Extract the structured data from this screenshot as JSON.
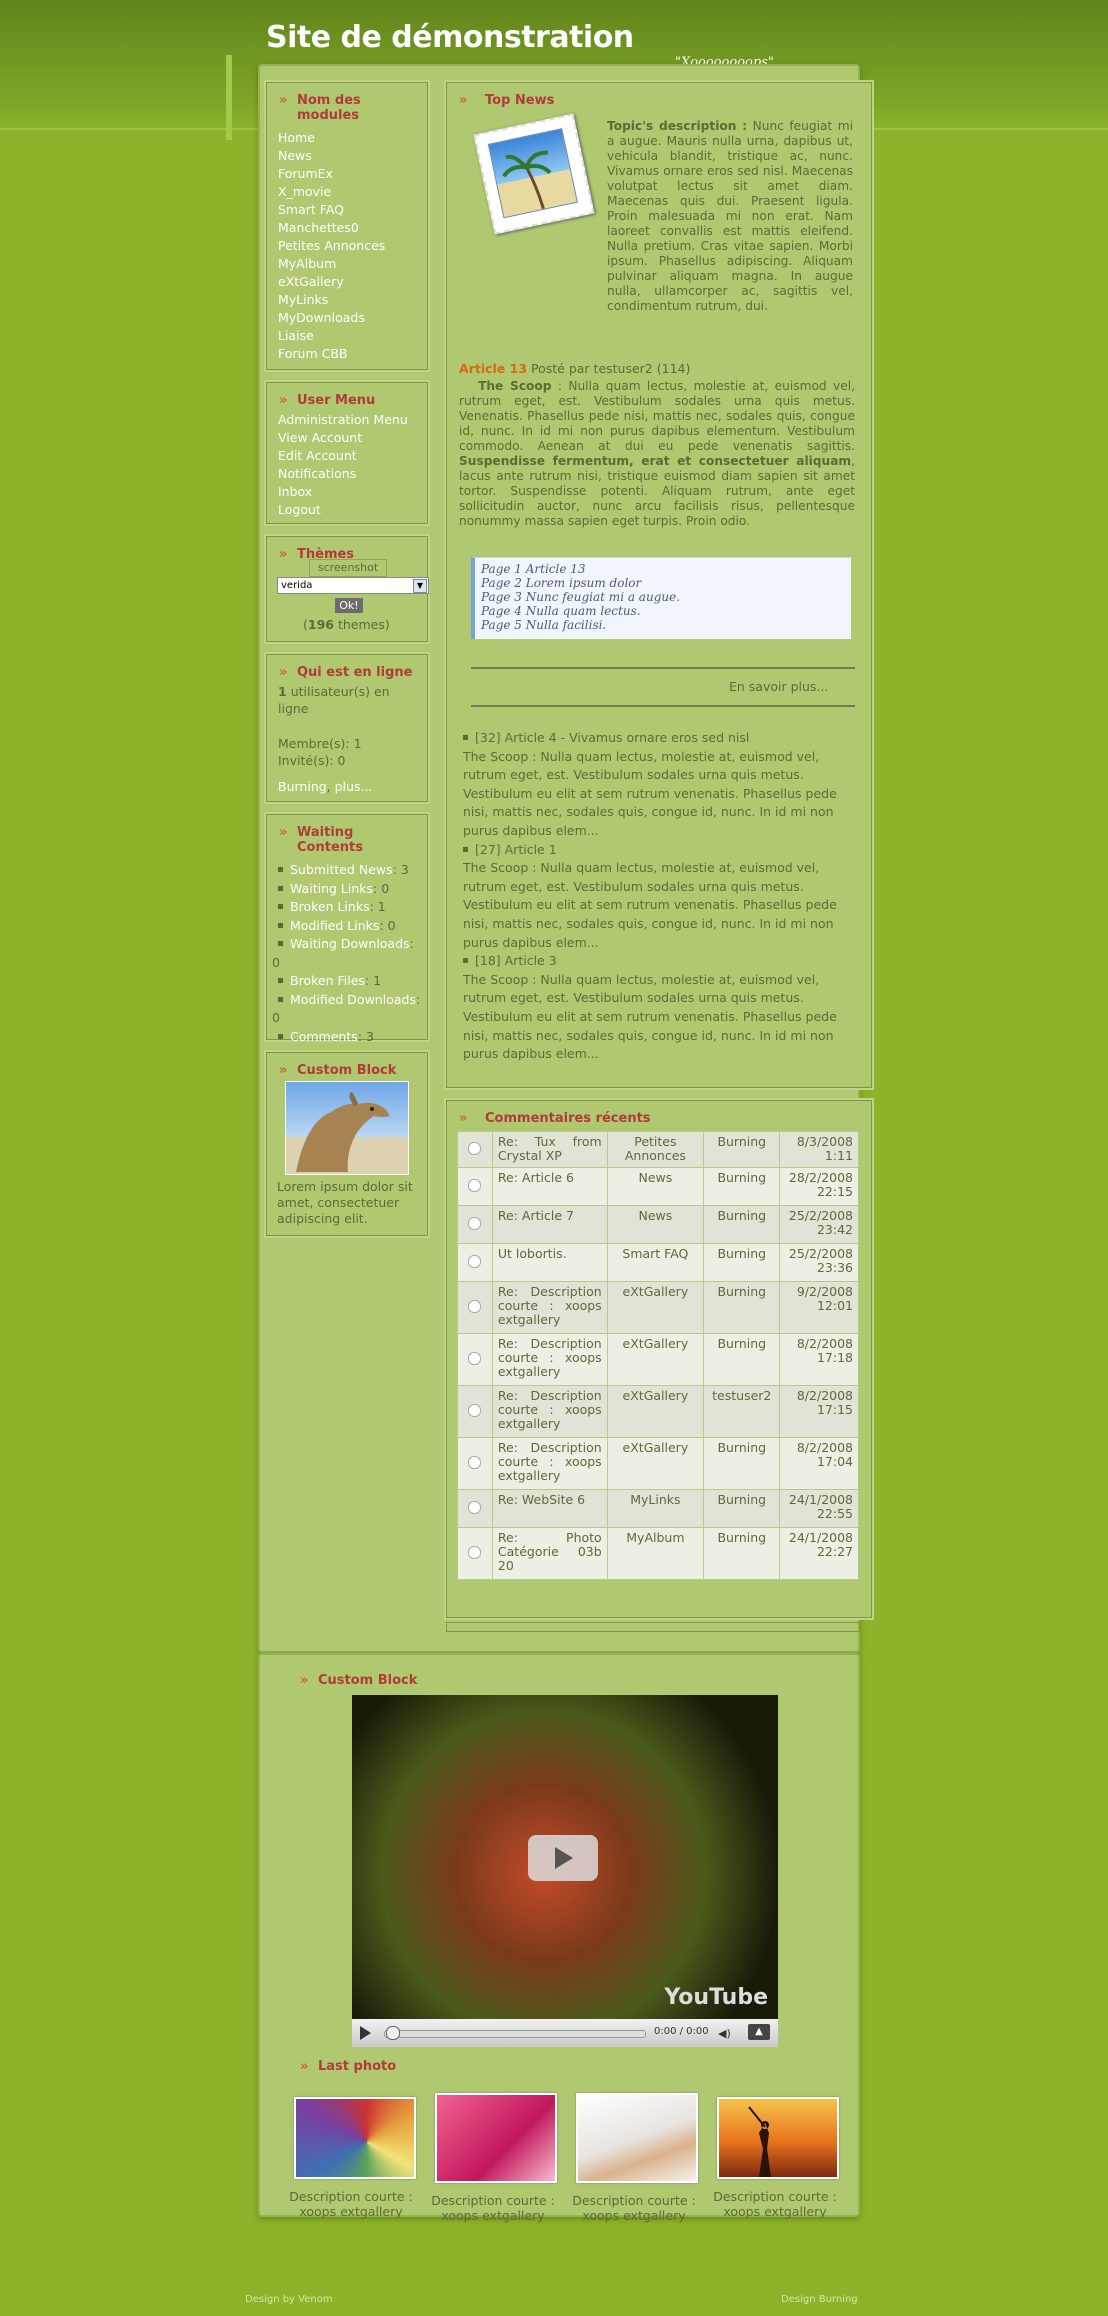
{
  "header": {
    "site_title": "Site de démonstration",
    "slogan": "\"Xoooooooops\""
  },
  "modules": {
    "title": "Nom des modules",
    "items": [
      "Home",
      "News",
      "ForumEx",
      "X_movie",
      "Smart FAQ",
      "Manchettes0",
      "Petites Annonces",
      "MyAlbum",
      "eXtGallery",
      "MyLinks",
      "MyDownloads",
      "Liaise",
      "Forum CBB"
    ]
  },
  "user_menu": {
    "title": "User Menu",
    "items": [
      "Administration Menu",
      "View Account",
      "Edit Account",
      "Notifications",
      "Inbox",
      "Logout"
    ]
  },
  "themes": {
    "title": "Thèmes",
    "screenshot_label": "screenshot",
    "selected": "verida",
    "ok_label": "Ok!",
    "count": "196",
    "count_suffix": "themes)",
    "paren_open": "("
  },
  "online": {
    "title": "Qui est en ligne",
    "count": "1",
    "count_suffix": "utilisateur(s) en ligne",
    "members": "Membre(s): 1",
    "guests": "Invité(s): 0",
    "user": "Burning",
    "more": "plus..."
  },
  "waiting": {
    "title": "Waiting Contents",
    "items": [
      {
        "label": "Submitted News",
        "value": "3"
      },
      {
        "label": "Waiting Links",
        "value": "0"
      },
      {
        "label": "Broken Links",
        "value": "1"
      },
      {
        "label": "Modified Links",
        "value": "0"
      },
      {
        "label": "Waiting Downloads",
        "value": "0"
      },
      {
        "label": "Broken Files",
        "value": "1"
      },
      {
        "label": "Modified Downloads",
        "value": "0"
      },
      {
        "label": "Comments",
        "value": "3"
      }
    ]
  },
  "custom_block": {
    "title": "Custom Block",
    "text": "Lorem ipsum dolor sit amet, consectetuer adipiscing elit."
  },
  "top_news": {
    "title": "Top News",
    "topic_label": "Topic's description :",
    "topic_text": "Nunc feugiat mi a augue. Mauris nulla urna, dapibus ut, vehicula blandit, tristique ac, nunc. Vivamus ornare eros sed nisl. Maecenas volutpat lectus sit amet diam. Maecenas quis dui. Praesent ligula. Proin malesuada mi non erat. Nam laoreet convallis est mattis eleifend. Nulla pretium. Cras vitae sapien. Morbi ipsum. Phasellus adipiscing. Aliquam pulvinar aliquam magna. In augue nulla, ullamcorper ac, sagittis vel, condimentum rutrum, dui.",
    "article_title": "Article 13",
    "posted_by": "Posté par testuser2 (114)",
    "scoop_label": "The Scoop",
    "scoop_text1": " : Nulla quam lectus, molestie at, euismod vel, rutrum eget, est. Vestibulum sodales urna quis metus. Venenatis. Phasellus pede nisi, mattis nec, sodales quis, congue id, nunc. In id mi non purus dapibus elementum. Vestibulum commodo. Aenean at dui eu pede venenatis sagittis. ",
    "scoop_bold": "Suspendisse fermentum, erat et consectetuer aliquam",
    "scoop_text2": ", lacus ante rutrum nisi, tristique euismod diam sapien sit amet tortor. Suspendisse potenti. Aliquam rutrum, ante eget sollicitudin auctor, nunc arcu facilisis risus, pellentesque nonummy massa sapien eget turpis. Proin odio.",
    "pages": [
      "Page 1 Article 13",
      "Page 2 Lorem ipsum dolor",
      "Page 3 Nunc feugiat mi a augue.",
      "Page 4 Nulla quam lectus.",
      "Page 5 Nulla facilisi."
    ],
    "read_more": "En savoir plus...",
    "others": [
      {
        "title": "[32] Article 4 - Vivamus ornare eros sed nisl",
        "text": "The Scoop : Nulla quam lectus, molestie at, euismod vel, rutrum eget, est. Vestibulum sodales urna quis metus. Vestibulum eu elit at sem rutrum venenatis. Phasellus pede nisi, mattis nec, sodales quis, congue id, nunc. In id mi non purus dapibus elem..."
      },
      {
        "title": "[27] Article 1",
        "text": "The Scoop : Nulla quam lectus, molestie at, euismod vel, rutrum eget, est. Vestibulum sodales urna quis metus. Vestibulum eu elit at sem rutrum venenatis. Phasellus pede nisi, mattis nec, sodales quis, congue id, nunc. In id mi non purus dapibus elem..."
      },
      {
        "title": "[18] Article 3",
        "text": "The Scoop : Nulla quam lectus, molestie at, euismod vel, rutrum eget, est. Vestibulum sodales urna quis metus. Vestibulum eu elit at sem rutrum venenatis. Phasellus pede nisi, mattis nec, sodales quis, congue id, nunc. In id mi non purus dapibus elem..."
      }
    ]
  },
  "comments": {
    "title": "Commentaires récents",
    "rows": [
      {
        "subject": "Re: Tux from Crystal XP",
        "module": "Petites Annonces",
        "user": "Burning",
        "date": "8/3/2008 1:11"
      },
      {
        "subject": "Re: Article 6",
        "module": "News",
        "user": "Burning",
        "date": "28/2/2008 22:15"
      },
      {
        "subject": "Re: Article 7",
        "module": "News",
        "user": "Burning",
        "date": "25/2/2008 23:42"
      },
      {
        "subject": "Ut lobortis.",
        "module": "Smart FAQ",
        "user": "Burning",
        "date": "25/2/2008 23:36"
      },
      {
        "subject": "Re: Description courte : xoops extgallery",
        "module": "eXtGallery",
        "user": "Burning",
        "date": "9/2/2008 12:01"
      },
      {
        "subject": "Re: Description courte : xoops extgallery",
        "module": "eXtGallery",
        "user": "Burning",
        "date": "8/2/2008 17:18"
      },
      {
        "subject": "Re: Description courte : xoops extgallery",
        "module": "eXtGallery",
        "user": "testuser2",
        "date": "8/2/2008 17:15"
      },
      {
        "subject": "Re: Description courte : xoops extgallery",
        "module": "eXtGallery",
        "user": "Burning",
        "date": "8/2/2008 17:04"
      },
      {
        "subject": "Re: WebSite 6",
        "module": "MyLinks",
        "user": "Burning",
        "date": "24/1/2008 22:55"
      },
      {
        "subject": "Re: Photo Catégorie 03b 20",
        "module": "MyAlbum",
        "user": "Burning",
        "date": "24/1/2008 22:27"
      }
    ]
  },
  "video_block": {
    "title": "Custom Block",
    "time": "0:00 / 0:00",
    "brand": "YouTube"
  },
  "last_photo": {
    "title": "Last photo",
    "captions": [
      "Description courte : xoops extgallery",
      "Description courte : xoops extgallery",
      "Description courte : xoops extgallery",
      "Description courte : xoops extgallery"
    ]
  },
  "footer": {
    "left": "Design by Venom",
    "right": "Design Burning"
  }
}
